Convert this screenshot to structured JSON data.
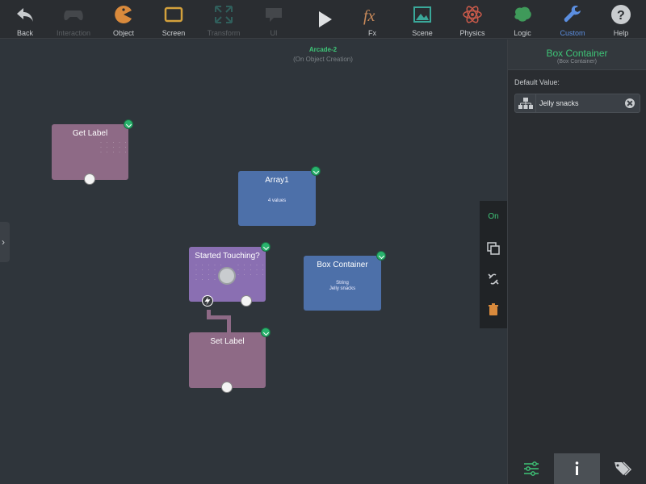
{
  "toolbar": {
    "items": [
      {
        "label": "Back",
        "icon": "back-arrow-icon",
        "state": "on"
      },
      {
        "label": "Interaction",
        "icon": "gamepad-icon",
        "state": "dim"
      },
      {
        "label": "Object",
        "icon": "pacman-icon",
        "state": "on"
      },
      {
        "label": "Screen",
        "icon": "screen-frame-icon",
        "state": "on"
      },
      {
        "label": "Transform",
        "icon": "expand-arrows-icon",
        "state": "dim"
      },
      {
        "label": "UI",
        "icon": "speech-bubble-icon",
        "state": "dim"
      },
      {
        "label": "",
        "icon": "play-icon",
        "state": "on"
      },
      {
        "label": "Fx",
        "icon": "fx-icon",
        "state": "on"
      },
      {
        "label": "Scene",
        "icon": "landscape-icon",
        "state": "on"
      },
      {
        "label": "Physics",
        "icon": "atom-icon",
        "state": "on"
      },
      {
        "label": "Logic",
        "icon": "brain-icon",
        "state": "on"
      },
      {
        "label": "Custom",
        "icon": "wrench-icon",
        "state": "active"
      },
      {
        "label": "Help",
        "icon": "help-icon",
        "state": "on"
      }
    ]
  },
  "canvas": {
    "title": "Arcade-2",
    "subtitle": "(On Object Creation)"
  },
  "nodes": {
    "get_label": {
      "title": "Get Label"
    },
    "array": {
      "title": "Array1",
      "body": "4 values"
    },
    "started": {
      "title": "Started Touching?"
    },
    "box": {
      "title": "Box Container",
      "body_line1": "String",
      "body_line2": "Jelly snacks"
    },
    "set_label": {
      "title": "Set Label"
    }
  },
  "mini_toolbar": {
    "on_label": "On"
  },
  "panel": {
    "title": "Box Container",
    "subtitle": "(Box Container)",
    "default_label": "Default Value:",
    "default_value": "Jelly snacks"
  },
  "colors": {
    "accent": "#3ec477",
    "active_tab": "#5b8ee0"
  }
}
